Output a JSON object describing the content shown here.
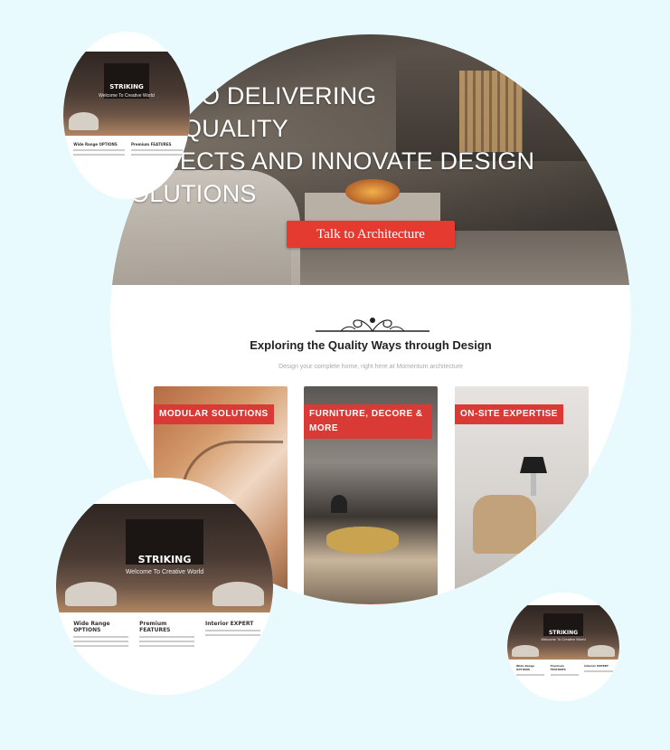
{
  "hero": {
    "headline_lines": [
      "TED TO DELIVERING",
      "QUALITY",
      "OJECTS AND INNOVATE DESIGN",
      "OLUTIONS"
    ],
    "cta_label": "Talk to Architecture"
  },
  "section": {
    "title": "Exploring the Quality Ways through Design",
    "subtitle": "Design your complete home, right here at Momentum architecture"
  },
  "cards": [
    {
      "label": "MODULAR SOLUTIONS"
    },
    {
      "label": "FURNITURE, DECORE & MORE"
    },
    {
      "label": "ON-SITE EXPERTISE"
    }
  ],
  "previews": {
    "brand": "STRIKING",
    "tagline": "Welcome To Creative World",
    "columns": [
      "Wide Range OPTIONS",
      "Premium FEATURES",
      "Interior EXPERT"
    ]
  },
  "colors": {
    "accent": "#e53a30",
    "background": "#e8fafe"
  }
}
